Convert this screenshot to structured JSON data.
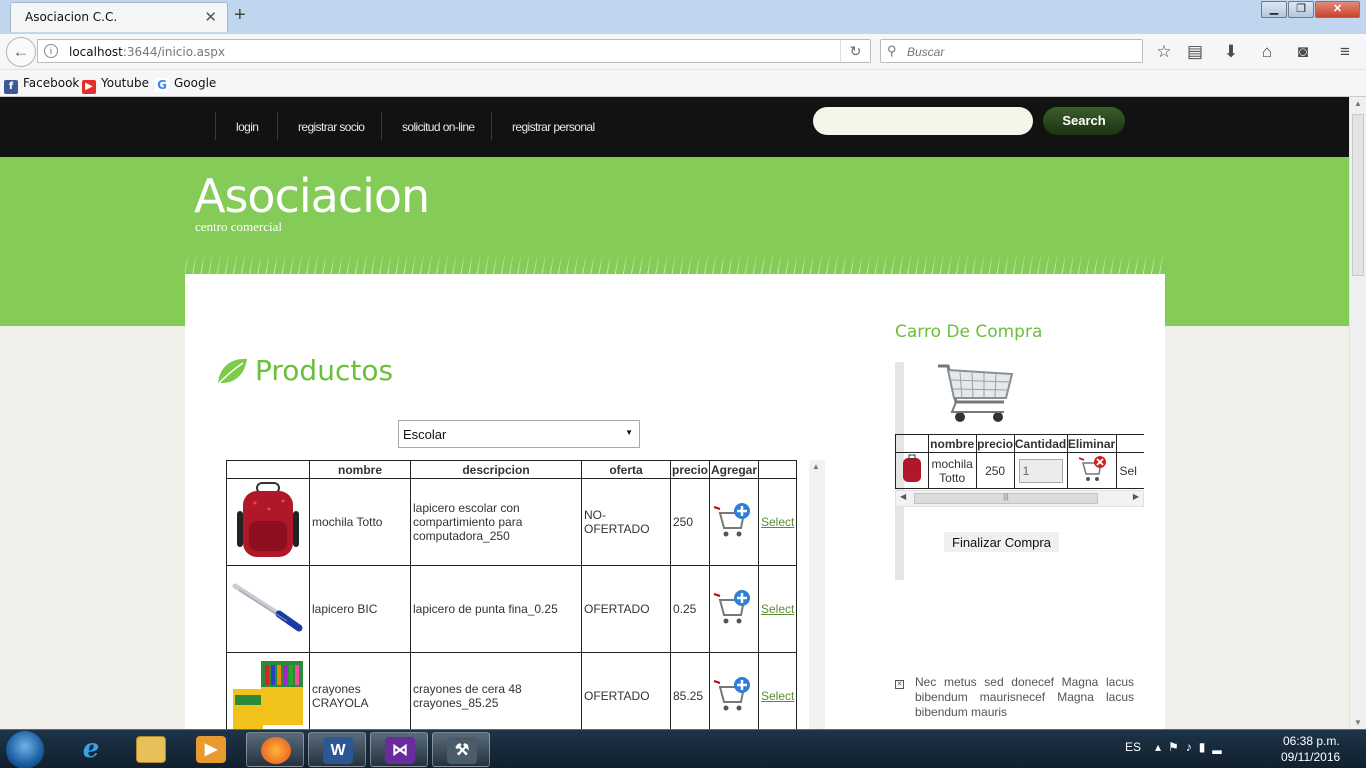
{
  "browser": {
    "tab_title": "Asociacion C.C.",
    "tab_close": "✕",
    "new_tab": "+",
    "url_host": "localhost",
    "url_rest": ":3644/inicio.aspx",
    "search_placeholder": "Buscar",
    "bookmarks": [
      {
        "label": "Facebook",
        "icon": "facebook-icon",
        "color": "#3b5998"
      },
      {
        "label": "Youtube",
        "icon": "youtube-icon",
        "color": "#e52d27"
      },
      {
        "label": "Google",
        "icon": "google-icon",
        "color": "#4285f4"
      }
    ]
  },
  "site": {
    "nav": [
      "login",
      "registrar socio",
      "solicitud on-line",
      "registrar personal"
    ],
    "search_button": "Search",
    "title": "Asociacion",
    "subtitle": "centro comercial",
    "colors": {
      "green": "#84cc57",
      "heading_green": "#6abf3b",
      "nav_bg": "#121212"
    }
  },
  "products": {
    "heading": "Productos",
    "category_selected": "Escolar",
    "columns": [
      "",
      "nombre",
      "descripcion",
      "oferta",
      "precio",
      "Agregar",
      ""
    ],
    "rows": [
      {
        "nombre": "mochila Totto",
        "descripcion": "lapicero escolar con compartimiento para computadora_250",
        "oferta": "NO-OFERTADO",
        "precio": "250",
        "select": "Select"
      },
      {
        "nombre": "lapicero BIC",
        "descripcion": "lapicero de punta fina_0.25",
        "oferta": "OFERTADO",
        "precio": "0.25",
        "select": "Select"
      },
      {
        "nombre": "crayones CRAYOLA",
        "descripcion": "crayones de cera 48 crayones_85.25",
        "oferta": "OFERTADO",
        "precio": "85.25",
        "select": "Select"
      }
    ]
  },
  "cart": {
    "heading": "Carro De Compra",
    "columns": [
      "",
      "nombre",
      "precio",
      "Cantidad",
      "Eliminar",
      ""
    ],
    "rows": [
      {
        "nombre": "mochila Totto",
        "precio": "250",
        "cantidad": "1",
        "select": "Sel"
      }
    ],
    "finalize_button": "Finalizar Compra"
  },
  "sidebar_text": "Nec metus sed donecef Magna lacus bibendum maurisnecef Magna lacus bibendum mauris",
  "taskbar": {
    "language": "ES",
    "time": "06:38 p.m.",
    "date": "09/11/2016"
  }
}
